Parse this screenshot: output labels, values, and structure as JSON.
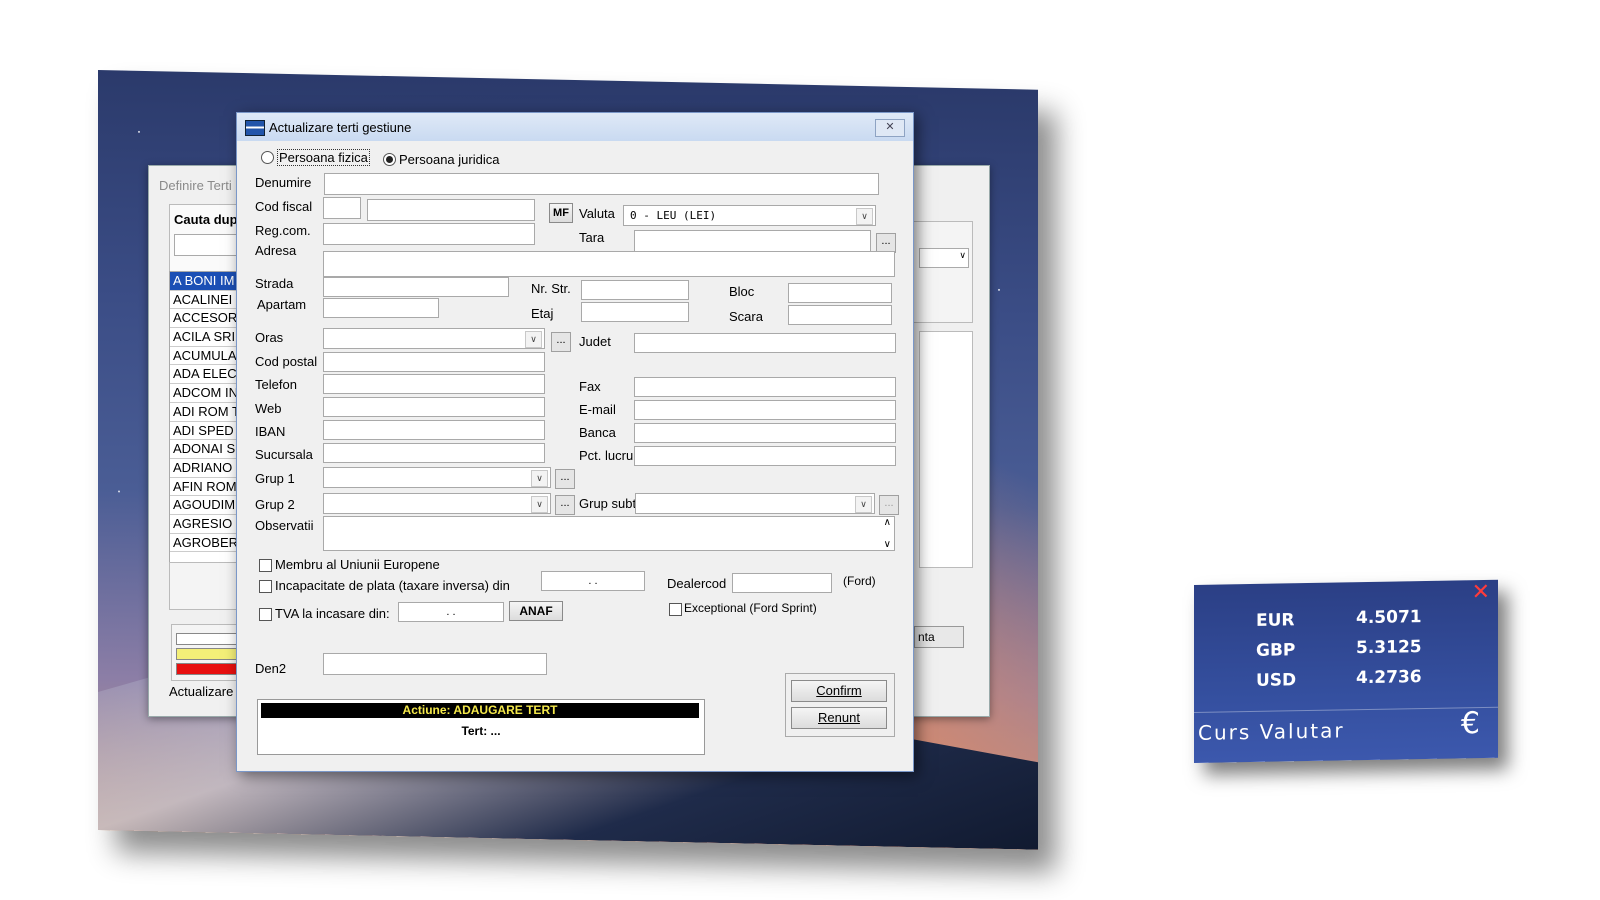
{
  "background_window": {
    "title": "Definire Terti",
    "search_label": "Cauta dup",
    "list": [
      "A BONI IM",
      "ACALINEI",
      "ACCESOR",
      "ACILA SRI",
      "ACUMULA",
      "ADA ELEC",
      "ADCOM IN",
      "ADI ROM T",
      "ADI SPED",
      "ADONAI S",
      "ADRIANO",
      "AFIN ROM",
      "AGOUDIM",
      "AGRESIO",
      "AGROBER"
    ],
    "status_text": "Actualizare",
    "right_button": "nta",
    "legend_colors": [
      "#ffffff",
      "#f4ef78",
      "#e81010"
    ]
  },
  "dialog": {
    "title": "Actualizare terti gestiune",
    "radio_fizica": "Persoana fizica",
    "radio_juridica": "Persoana juridica",
    "labels": {
      "denumire": "Denumire",
      "cod_fiscal": "Cod fiscal",
      "reg_com": "Reg.com.",
      "adresa": "Adresa",
      "strada": "Strada",
      "apartam": "Apartam",
      "nr_str": "Nr. Str.",
      "etaj": "Etaj",
      "bloc": "Bloc",
      "scara": "Scara",
      "oras": "Oras",
      "judet": "Judet",
      "cod_postal": "Cod postal",
      "telefon": "Telefon",
      "fax": "Fax",
      "web": "Web",
      "email": "E-mail",
      "iban": "IBAN",
      "banca": "Banca",
      "sucursala": "Sucursala",
      "pct_lucru": "Pct. lucru",
      "grup1": "Grup 1",
      "grup2": "Grup 2",
      "grup_subt": "Grup subt.",
      "observatii": "Observatii",
      "valuta": "Valuta",
      "tara": "Tara",
      "den2": "Den2",
      "dealercod": "Dealercod",
      "ford": "(Ford)"
    },
    "mf_button": "MF",
    "valuta_value": "0 - LEU (LEI)",
    "dots": "...",
    "checkboxes": {
      "ue": "Membru al Uniunii Europene",
      "incapacitate": "Incapacitate de plata (taxare inversa) din",
      "tva": "TVA la incasare din:",
      "exceptional": "Exceptional (Ford Sprint)"
    },
    "date_placeholder": " .  . ",
    "anaf_button": "ANAF",
    "action_text": "Actiune: ADAUGARE TERT",
    "tert_text": "Tert: ...",
    "confirm_button": "Confirm",
    "renunt_button": "Renunt"
  },
  "currency_widget": {
    "rates": [
      {
        "code": "EUR",
        "value": "4.5071"
      },
      {
        "code": "GBP",
        "value": "5.3125"
      },
      {
        "code": "USD",
        "value": "4.2736"
      }
    ],
    "caption": "Curs Valutar",
    "close": "✕",
    "euro_symbol": "€",
    "colors": {
      "background": "#3550a0",
      "close": "#ff3b3b"
    }
  }
}
